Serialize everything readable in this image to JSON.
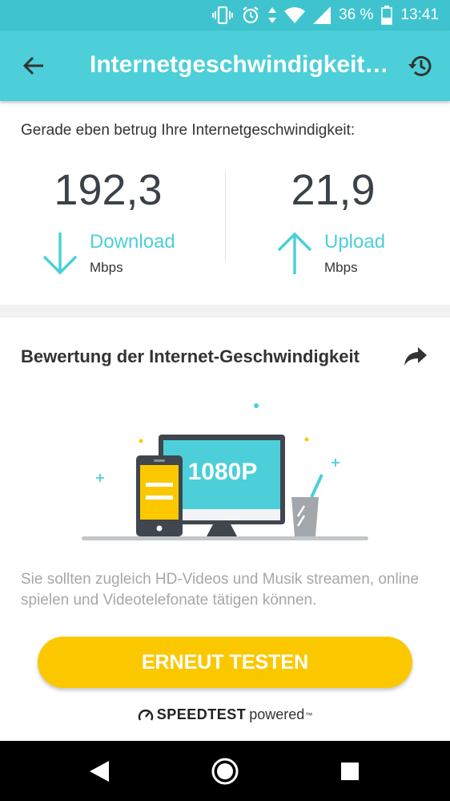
{
  "status_bar": {
    "battery_percent": "36 %",
    "time": "13:41",
    "icons": [
      "vibrate-icon",
      "alarm-icon",
      "data-arrows-icon",
      "wifi-icon",
      "signal-icon",
      "battery-icon"
    ]
  },
  "app_bar": {
    "title": "Internetgeschwindigkeit t...",
    "back_icon": "arrow-left-icon",
    "history_icon": "history-icon"
  },
  "result": {
    "intro": "Gerade eben betrug Ihre Internetgeschwindigkeit:",
    "download": {
      "value": "192,3",
      "label": "Download",
      "unit": "Mbps",
      "icon": "arrow-down-icon"
    },
    "upload": {
      "value": "21,9",
      "label": "Upload",
      "unit": "Mbps",
      "icon": "arrow-up-icon"
    }
  },
  "rating": {
    "heading": "Bewertung der Internet-Geschwindigkeit",
    "share_icon": "share-icon",
    "illustration_text": "1080P",
    "description": "Sie sollten zugleich HD-Videos und Musik streamen, online spielen und Videotelefonate tätigen können.",
    "retest_label": "ERNEUT TESTEN",
    "powered_brand": "SPEEDTEST",
    "powered_suffix": "powered",
    "powered_tm": "™"
  },
  "nav_bar": {
    "icons": [
      "nav-back-icon",
      "nav-home-icon",
      "nav-recents-icon"
    ]
  },
  "colors": {
    "accent": "#4ccfd8",
    "status_bar": "#3fc4cf",
    "button": "#fbc800",
    "text_dark": "#3a4149",
    "text_muted": "#a7a7a7"
  }
}
